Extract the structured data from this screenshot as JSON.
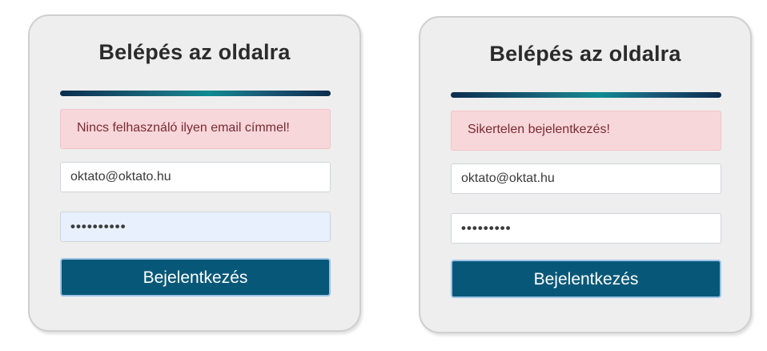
{
  "cards": [
    {
      "title": "Belépés az oldalra",
      "alert": "Nincs felhasználó ilyen email címmel!",
      "email_value": "oktato@oktato.hu",
      "password_mask": "••••••••••",
      "submit_label": "Bejelentkezés"
    },
    {
      "title": "Belépés az oldalra",
      "alert": "Sikertelen bejelentkezés!",
      "email_value": "oktato@oktat.hu",
      "password_mask": "•••••••••",
      "submit_label": "Bejelentkezés"
    }
  ],
  "colors": {
    "card_bg": "#eeeeee",
    "alert_bg": "#f8d7da",
    "alert_text": "#7a2a33",
    "button_bg": "#075878",
    "autofill_bg": "#e8f0fe"
  }
}
